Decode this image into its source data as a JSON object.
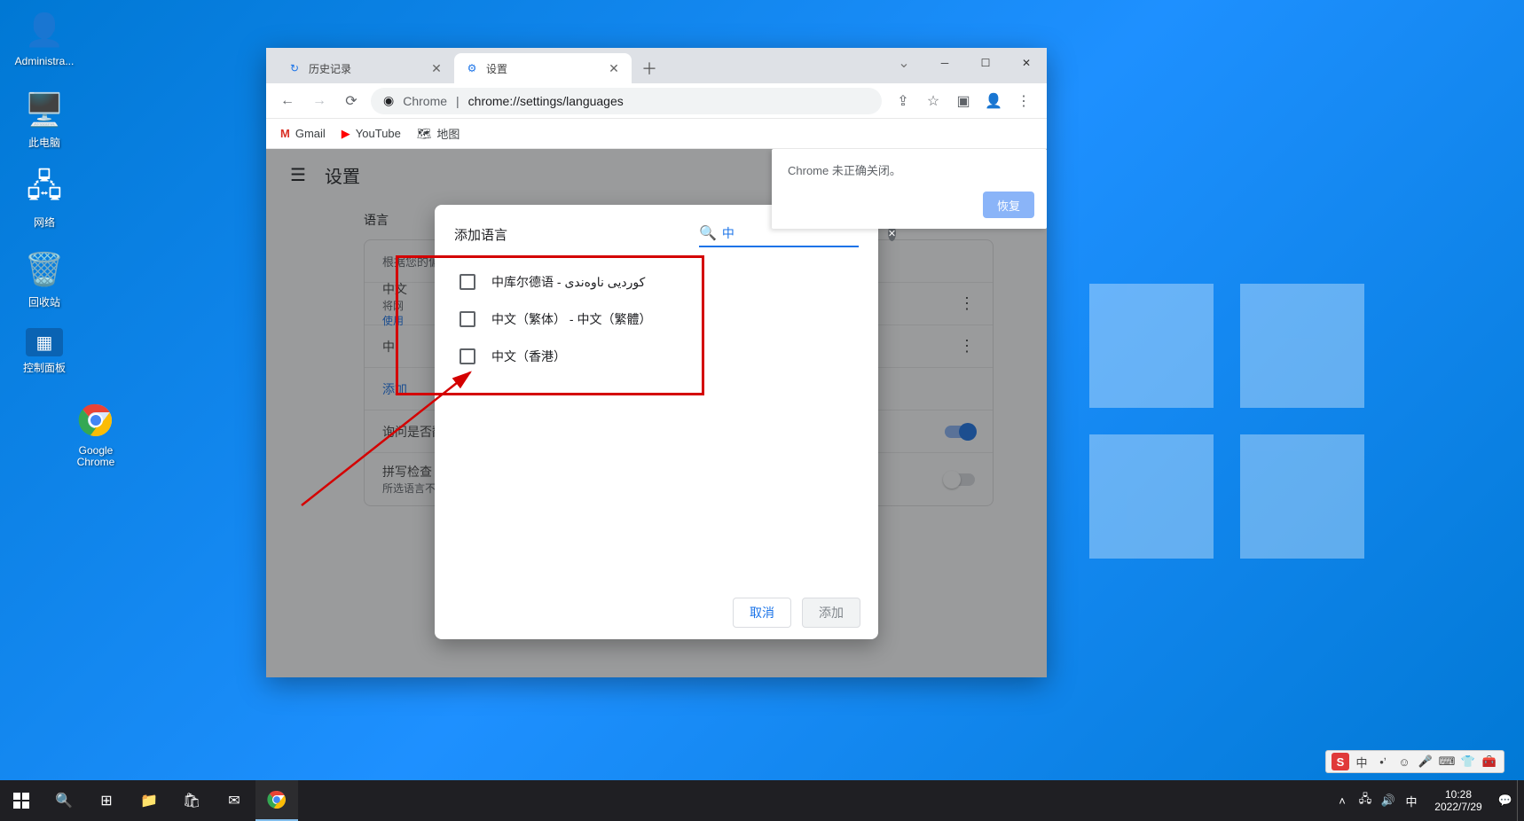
{
  "desktop": {
    "icons": [
      {
        "label": "Administra...",
        "glyph": "👤"
      },
      {
        "label": "此电脑",
        "glyph": "🖥️"
      },
      {
        "label": "网络",
        "glyph": "🖧"
      },
      {
        "label": "回收站",
        "glyph": "🗑️"
      },
      {
        "label": "控制面板",
        "glyph": "⚙️"
      },
      {
        "label": "Google Chrome",
        "glyph": "◉"
      }
    ]
  },
  "chrome": {
    "tabs": [
      {
        "title": "历史记录",
        "active": false
      },
      {
        "title": "设置",
        "active": true
      }
    ],
    "address": {
      "prefix": "Chrome",
      "sep": "|",
      "url": "chrome://settings/languages"
    },
    "bookmarks": [
      {
        "label": "Gmail"
      },
      {
        "label": "YouTube"
      },
      {
        "label": "地图"
      }
    ],
    "settings_header": "设置",
    "section_title": "语言",
    "card": {
      "desc": "根据您的偏",
      "row1_title": "中文",
      "row1_l1": "将网",
      "row1_l2": "使用",
      "row2_title": "中",
      "add_link": "添加",
      "ask_translate": "询问是否翻",
      "spell_title": "拼写检查",
      "spell_desc": "所选语言不"
    },
    "crash": {
      "text": "Chrome 未正确关闭。",
      "button": "恢复"
    }
  },
  "dialog": {
    "title": "添加语言",
    "search_value": "中",
    "items": [
      {
        "label": "中库尔德语 - کوردیی ناوەندی"
      },
      {
        "label": "中文（繁体） - 中文（繁體）"
      },
      {
        "label": "中文（香港）"
      }
    ],
    "cancel": "取消",
    "add": "添加"
  },
  "taskbar": {
    "time": "10:28",
    "date": "2022/7/29",
    "ime_lang": "中"
  },
  "ime_strip": {
    "s": "S",
    "lang": "中",
    "half": "▸"
  }
}
